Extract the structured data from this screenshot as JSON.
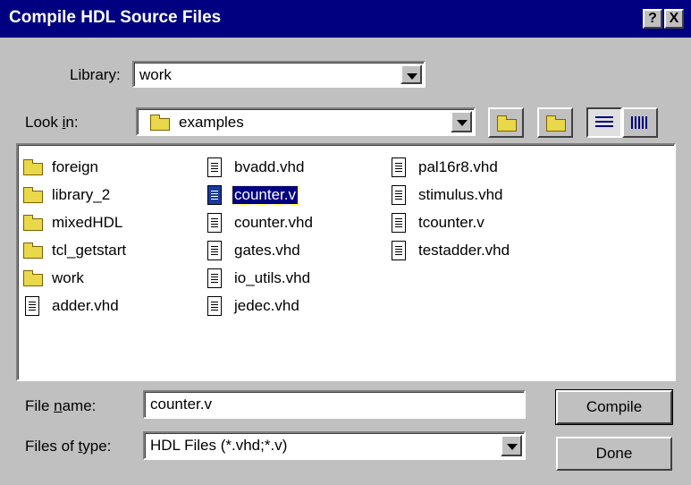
{
  "window": {
    "title": "Compile HDL Source Files",
    "help_glyph": "?",
    "close_glyph": "X"
  },
  "library": {
    "label": "Library:",
    "value": "work"
  },
  "look_in": {
    "label_pre": "Look ",
    "label_u": "i",
    "label_post": "n:",
    "value": "examples"
  },
  "toolbar": {
    "up_icon": "folder-up-icon",
    "new_icon": "new-folder-icon",
    "list_icon": "list-view-icon",
    "details_icon": "details-view-icon"
  },
  "files": [
    {
      "name": "foreign",
      "kind": "folder"
    },
    {
      "name": "library_2",
      "kind": "folder"
    },
    {
      "name": "mixedHDL",
      "kind": "folder"
    },
    {
      "name": "tcl_getstart",
      "kind": "folder"
    },
    {
      "name": "work",
      "kind": "folder"
    },
    {
      "name": "adder.vhd",
      "kind": "file"
    },
    {
      "name": "bvadd.vhd",
      "kind": "file"
    },
    {
      "name": "counter.v",
      "kind": "vfile",
      "selected": true
    },
    {
      "name": "counter.vhd",
      "kind": "file"
    },
    {
      "name": "gates.vhd",
      "kind": "file"
    },
    {
      "name": "io_utils.vhd",
      "kind": "file"
    },
    {
      "name": "jedec.vhd",
      "kind": "file"
    },
    {
      "name": "pal16r8.vhd",
      "kind": "file"
    },
    {
      "name": "stimulus.vhd",
      "kind": "file"
    },
    {
      "name": "tcounter.v",
      "kind": "vfile"
    },
    {
      "name": "testadder.vhd",
      "kind": "file"
    }
  ],
  "file_name": {
    "label_pre": "File ",
    "label_u": "n",
    "label_post": "ame:",
    "value": "counter.v"
  },
  "file_type": {
    "label_pre": "Files of ",
    "label_u": "t",
    "label_post": "ype:",
    "value": "HDL Files (*.vhd;*.v)"
  },
  "buttons": {
    "compile": "Compile",
    "done": "Done"
  }
}
